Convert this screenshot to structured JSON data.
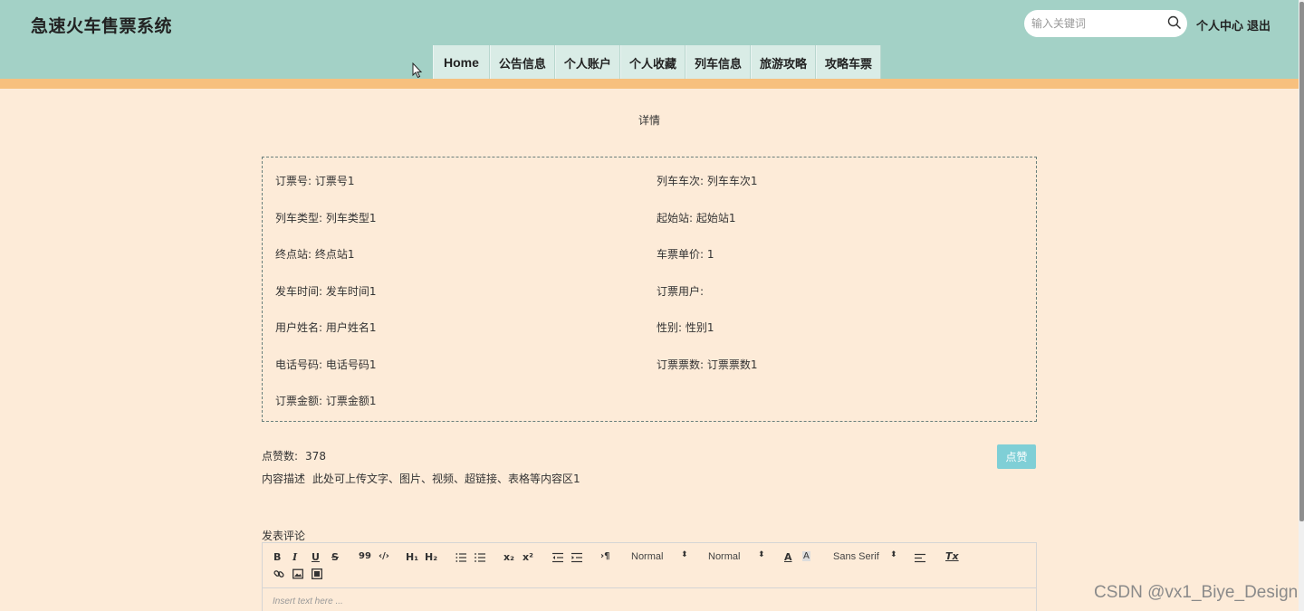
{
  "header": {
    "site_title": "急速火车售票系统",
    "search_placeholder": "输入关键词",
    "personal_center": "个人中心",
    "logout": "退出",
    "nav": [
      "Home",
      "公告信息",
      "个人账户",
      "个人收藏",
      "列车信息",
      "旅游攻略",
      "攻略车票"
    ]
  },
  "main": {
    "heading": "详情",
    "fields": {
      "order_no": "订票号: 订票号1",
      "train_no": "列车车次: 列车车次1",
      "train_type": "列车类型: 列车类型1",
      "start_station": "起始站: 起始站1",
      "end_station": "终点站: 终点站1",
      "unit_price": "车票单价: 1",
      "depart_time": "发车时间: 发车时间1",
      "order_user": "订票用户:",
      "user_name": "用户姓名: 用户姓名1",
      "gender": "性别: 性别1",
      "phone": "电话号码: 电话号码1",
      "ticket_count": "订票票数: 订票票数1",
      "amount": "订票金额: 订票金额1"
    },
    "likes_label": "点赞数:",
    "likes_count": "378",
    "like_button": "点赞",
    "desc_label": "内容描述",
    "desc_value": "此处可上传文字、图片、视频、超链接、表格等内容区1",
    "comment_label": "发表评论"
  },
  "editor": {
    "bold": "B",
    "italic": "I",
    "underline": "U",
    "strike": "S",
    "quote": "99",
    "code": "‹/›",
    "h1": "H₁",
    "h2": "H₂",
    "sub": "x₂",
    "sup": "x²",
    "pilcrow": "›¶",
    "size_select": "Normal",
    "header_select": "Normal",
    "font_select": "Sans Serif",
    "font_color": "A",
    "clean": "Tx",
    "placeholder": "Insert text here ..."
  },
  "watermark": "CSDN @vx1_Biye_Design",
  "colors": {
    "header_bg": "#a3d1c6",
    "accent_bar": "#f7c07e",
    "page_bg": "#fdebd8",
    "like_button": "#7fcfd6"
  }
}
